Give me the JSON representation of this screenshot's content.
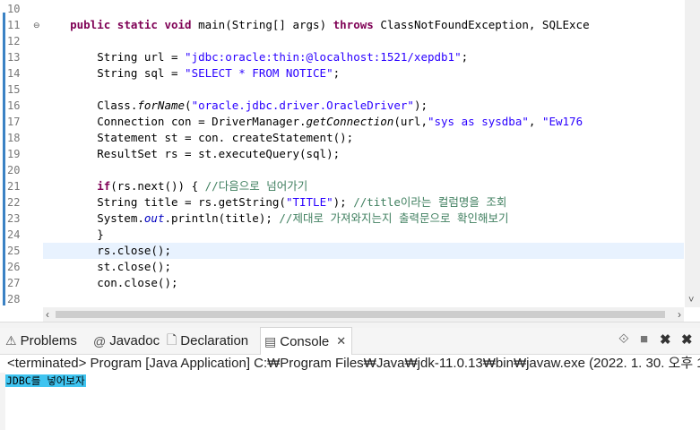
{
  "editor": {
    "lines": [
      {
        "n": "10",
        "fold": "",
        "segs": []
      },
      {
        "n": "11",
        "fold": "⊖",
        "segs": [
          [
            "    ",
            ""
          ],
          [
            "public static void ",
            "kw"
          ],
          [
            "main(String[] args) ",
            ""
          ],
          [
            "throws ",
            "kw"
          ],
          [
            "ClassNotFoundException, SQLExce",
            ""
          ]
        ]
      },
      {
        "n": "12",
        "fold": "",
        "segs": []
      },
      {
        "n": "13",
        "fold": "",
        "segs": [
          [
            "        String url = ",
            ""
          ],
          [
            "\"jdbc:oracle:thin:@localhost:1521/xepdb1\"",
            "str"
          ],
          [
            ";",
            ""
          ]
        ]
      },
      {
        "n": "14",
        "fold": "",
        "segs": [
          [
            "        String sql = ",
            ""
          ],
          [
            "\"SELECT * FROM NOTICE\"",
            "str"
          ],
          [
            ";",
            ""
          ]
        ]
      },
      {
        "n": "15",
        "fold": "",
        "segs": []
      },
      {
        "n": "16",
        "fold": "",
        "segs": [
          [
            "        Class.",
            ""
          ],
          [
            "forName",
            "it"
          ],
          [
            "(",
            ""
          ],
          [
            "\"oracle.jdbc.driver.OracleDriver\"",
            "str"
          ],
          [
            ");",
            ""
          ]
        ]
      },
      {
        "n": "17",
        "fold": "",
        "segs": [
          [
            "        Connection con = DriverManager.",
            ""
          ],
          [
            "getConnection",
            "it"
          ],
          [
            "(url,",
            ""
          ],
          [
            "\"sys as sysdba\"",
            "str"
          ],
          [
            ", ",
            ""
          ],
          [
            "\"Ew176",
            "str"
          ]
        ]
      },
      {
        "n": "18",
        "fold": "",
        "segs": [
          [
            "        Statement st = con. createStatement();",
            ""
          ]
        ]
      },
      {
        "n": "19",
        "fold": "",
        "segs": [
          [
            "        ResultSet rs = st.executeQuery(sql);",
            ""
          ]
        ]
      },
      {
        "n": "20",
        "fold": "",
        "segs": []
      },
      {
        "n": "21",
        "fold": "",
        "segs": [
          [
            "        ",
            ""
          ],
          [
            "if",
            "kw"
          ],
          [
            "(rs.next()) { ",
            ""
          ],
          [
            "//다음으로 넘어가기",
            "cm"
          ]
        ]
      },
      {
        "n": "22",
        "fold": "",
        "segs": [
          [
            "        String title = rs.getString(",
            ""
          ],
          [
            "\"TITLE\"",
            "str"
          ],
          [
            "); ",
            ""
          ],
          [
            "//title이라는 컬럼명을 조회",
            "cm"
          ]
        ]
      },
      {
        "n": "23",
        "fold": "",
        "segs": [
          [
            "        System.",
            ""
          ],
          [
            "out",
            "fld"
          ],
          [
            ".println(title); ",
            ""
          ],
          [
            "//제대로 가져와지는지 출력문으로 확인해보기",
            "cm"
          ]
        ]
      },
      {
        "n": "24",
        "fold": "",
        "segs": [
          [
            "        }",
            ""
          ]
        ]
      },
      {
        "n": "25",
        "fold": "",
        "segs": [
          [
            "        rs.close();",
            ""
          ]
        ]
      },
      {
        "n": "26",
        "fold": "",
        "segs": [
          [
            "        st.close();",
            ""
          ]
        ]
      },
      {
        "n": "27",
        "fold": "",
        "segs": [
          [
            "        con.close();",
            ""
          ]
        ]
      },
      {
        "n": "28",
        "fold": "",
        "segs": []
      }
    ],
    "current_line": "25"
  },
  "tabs": [
    {
      "label": "Problems",
      "icon": "problems-icon",
      "glyph": "⚠",
      "active": false
    },
    {
      "label": "Javadoc",
      "icon": "javadoc-icon",
      "glyph": "@",
      "active": false
    },
    {
      "label": "Declaration",
      "icon": "declaration-icon",
      "glyph": "🗋",
      "active": false
    },
    {
      "label": "Console",
      "icon": "console-icon",
      "glyph": "▤",
      "active": true
    }
  ],
  "console": {
    "header": "<terminated> Program [Java Application] C:₩Program Files₩Java₩jdk-11.0.13₩bin₩javaw.exe  (2022. 1. 30. 오후 1",
    "output": "JDBC를 넣어보자"
  },
  "colors": {
    "keyword": "#7f0055",
    "string": "#2a00ff",
    "comment": "#3f7f5f",
    "selection": "#3fc4f0"
  }
}
